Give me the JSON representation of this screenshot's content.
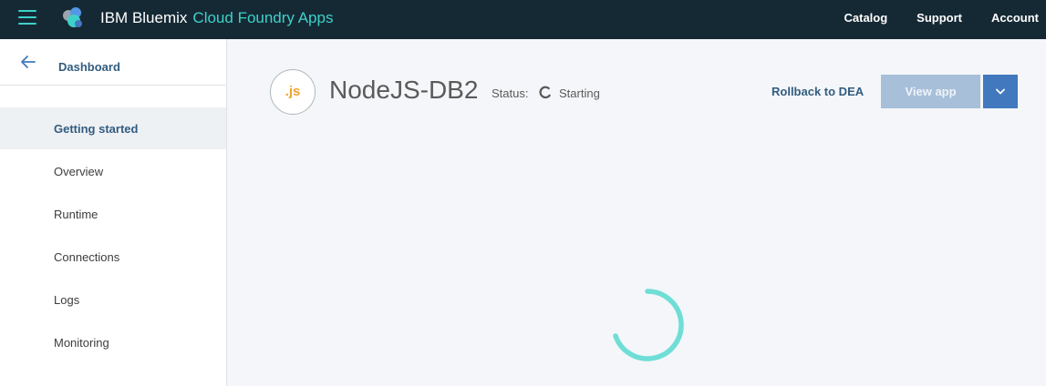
{
  "topbar": {
    "brand": "IBM Bluemix",
    "section": "Cloud Foundry Apps",
    "nav": [
      "Catalog",
      "Support",
      "Account"
    ]
  },
  "sidebar": {
    "back_label": "Dashboard",
    "items": [
      {
        "label": "Getting started",
        "active": true
      },
      {
        "label": "Overview",
        "active": false
      },
      {
        "label": "Runtime",
        "active": false
      },
      {
        "label": "Connections",
        "active": false
      },
      {
        "label": "Logs",
        "active": false
      },
      {
        "label": "Monitoring",
        "active": false
      }
    ]
  },
  "app": {
    "badge": ".js",
    "name": "NodeJS-DB2",
    "status_label": "Status:",
    "status_value": "Starting"
  },
  "actions": {
    "rollback": "Rollback to DEA",
    "view_app": "View app"
  },
  "colors": {
    "topbar_bg": "#152935",
    "accent_teal": "#3ed1c9",
    "link_blue": "#325c80",
    "button_blue": "#4178be",
    "disabled_button": "#a7bfd9",
    "badge_orange": "#f0a430"
  },
  "icons": {
    "menu": "hamburger-icon",
    "logo": "bluemix-logo-icon",
    "back": "arrow-left-icon",
    "status": "spinner-icon",
    "dropdown": "caret-down-icon",
    "loader": "loading-spinner-icon"
  }
}
